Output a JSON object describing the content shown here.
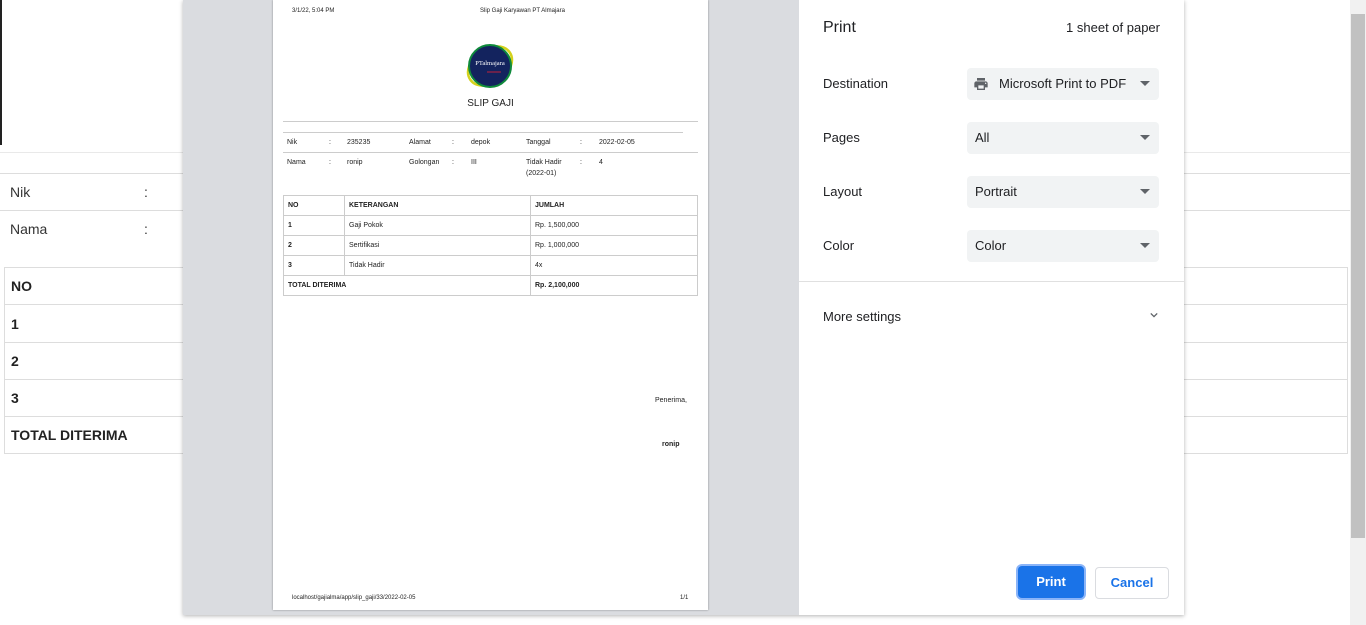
{
  "background": {
    "nik_label": "Nik",
    "nama_label": "Nama",
    "colon": ":",
    "rows": [
      "NO",
      "1",
      "2",
      "3",
      "TOTAL DITERIMA"
    ]
  },
  "preview": {
    "header_datetime": "3/1/22, 5:04 PM",
    "header_title": "Slip Gaji Karyawan PT Almajara",
    "logo_text": "PTalmajara",
    "slip_title": "SLIP GAJI",
    "info": {
      "nik_label": "Nik",
      "nik_value": "235235",
      "alamat_label": "Alamat",
      "alamat_value": "depok",
      "tanggal_label": "Tanggal",
      "tanggal_value": "2022-02-05",
      "nama_label": "Nama",
      "nama_value": "ronip",
      "golongan_label": "Golongan",
      "golongan_value": "III",
      "tidak_hadir_label": "Tidak Hadir",
      "tidak_hadir_period": "(2022-01)",
      "tidak_hadir_value": "4",
      "colon": ":"
    },
    "table": {
      "headers": [
        "NO",
        "KETERANGAN",
        "JUMLAH"
      ],
      "rows": [
        [
          "1",
          "Gaji Pokok",
          "Rp. 1,500,000"
        ],
        [
          "2",
          "Sertifikasi",
          "Rp. 1,000,000"
        ],
        [
          "3",
          "Tidak Hadir",
          "4x"
        ]
      ],
      "total_label": "TOTAL DITERIMA",
      "total_value": "Rp. 2,100,000"
    },
    "penerima_label": "Penerima,",
    "penerima_name": "ronip",
    "footer_url": "localhost/gajialma/app/slip_gaji/33/2022-02-05",
    "footer_page": "1/1"
  },
  "print": {
    "title": "Print",
    "sheets": "1 sheet of paper",
    "destination_label": "Destination",
    "destination_value": "Microsoft Print to PDF",
    "pages_label": "Pages",
    "pages_value": "All",
    "layout_label": "Layout",
    "layout_value": "Portrait",
    "color_label": "Color",
    "color_value": "Color",
    "more_settings": "More settings",
    "print_button": "Print",
    "cancel_button": "Cancel",
    "accent_color": "#1a73e8"
  }
}
